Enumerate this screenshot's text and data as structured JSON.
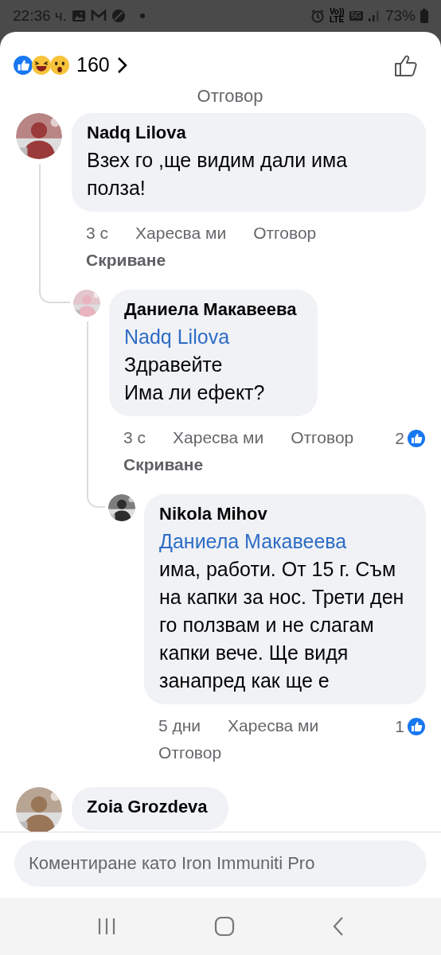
{
  "status_bar": {
    "time": "22:36 ч.",
    "volte": [
      "Vo))",
      "LTE"
    ],
    "network": "5G",
    "battery": "73%"
  },
  "header": {
    "reaction_count": "160"
  },
  "cut_action": "Отговор",
  "comments": [
    {
      "author": "Nadq Lilova",
      "text": "Взех го ,ще видим дали има полза!",
      "time": "3 с",
      "like": "Харесва ми",
      "reply": "Отговор",
      "hide": "Скриване",
      "children": [
        {
          "author": "Даниела Макавеева",
          "mention": "Nadq Lilova",
          "text": "Здравейте\nИма ли ефект?",
          "time": "3 с",
          "like": "Харесва ми",
          "reply": "Отговор",
          "hide": "Скриване",
          "likes": "2",
          "children": [
            {
              "author": "Nikola Mihov",
              "mention": "Даниела Макавеева",
              "text": "има, работи. От 15 г. Съм на капки за нос. Трети ден го ползвам и не слагам капки вече. Ще видя занапред как ще е",
              "time": "5 дни",
              "like": "Харесва ми",
              "reply": "Отговор",
              "likes": "1"
            }
          ]
        }
      ]
    },
    {
      "author": "Zoia Grozdeva"
    }
  ],
  "composer": {
    "placeholder": "Коментиране като Iron Immuniti Pro"
  }
}
